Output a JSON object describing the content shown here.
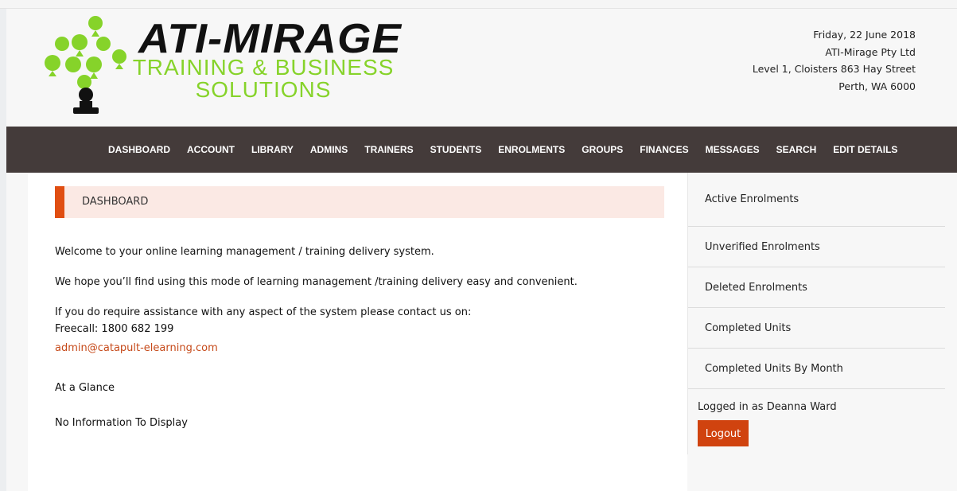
{
  "header": {
    "logo": {
      "title": "ATI-MIRAGE",
      "subtitle_line1": "TRAINING & BUSINESS",
      "subtitle_line2": "SOLUTIONS"
    },
    "date": "Friday, 22 June 2018",
    "company": "ATI-Mirage Pty Ltd",
    "address_line1": "Level 1, Cloisters 863 Hay Street",
    "address_line2": "Perth, WA 6000"
  },
  "nav": {
    "items": [
      "DASHBOARD",
      "ACCOUNT",
      "LIBRARY",
      "ADMINS",
      "TRAINERS",
      "STUDENTS",
      "ENROLMENTS",
      "GROUPS",
      "FINANCES",
      "MESSAGES",
      "SEARCH",
      "EDIT DETAILS"
    ]
  },
  "main": {
    "section_title": "DASHBOARD",
    "welcome": "Welcome to your online learning management / training delivery system.",
    "hope": "We hope you’ll find using this mode of learning management /training delivery easy and convenient.",
    "assist": "If you do require assistance with any aspect of the system please contact us on:",
    "freecall": "Freecall: 1800 682 199",
    "email": "admin@catapult-elearning.com",
    "glance_heading": "At a Glance",
    "no_info": "No Information To Display"
  },
  "sidebar": {
    "items": [
      "Active Enrolments",
      "Unverified Enrolments",
      "Deleted Enrolments",
      "Completed Units",
      "Completed Units By Month"
    ],
    "logged_in": "Logged in as Deanna Ward",
    "logout": "Logout"
  },
  "colors": {
    "nav_bg": "#443b3a",
    "accent": "#e04e12",
    "logo_green": "#86d32a",
    "link": "#c64a1a"
  }
}
